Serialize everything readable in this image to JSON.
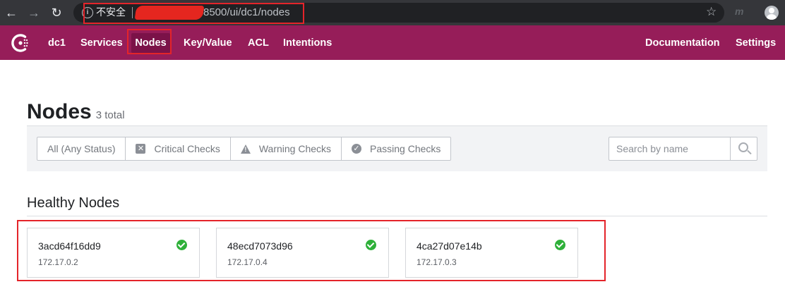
{
  "browser": {
    "back_icon": "arrow-left-icon",
    "forward_icon": "arrow-right-icon",
    "reload_icon": "reload-icon",
    "security_label": "不安全",
    "url_visible": "8500/ui/dc1/nodes",
    "bookmark_icon": "star-icon"
  },
  "header": {
    "accent_color": "#961d59",
    "datacenter": "dc1",
    "nav": {
      "services": "Services",
      "nodes": "Nodes",
      "keyvalue": "Key/Value",
      "acl": "ACL",
      "intentions": "Intentions",
      "documentation": "Documentation",
      "settings": "Settings"
    },
    "active_item": "Nodes"
  },
  "page": {
    "title": "Nodes",
    "count": "3 total"
  },
  "filters": {
    "options": [
      "All (Any Status)",
      "Critical Checks",
      "Warning Checks",
      "Passing Checks"
    ],
    "search_placeholder": "Search by name"
  },
  "section": {
    "title": "Healthy Nodes"
  },
  "nodes": [
    {
      "name": "3acd64f16dd9",
      "address": "172.17.0.2",
      "status": "passing"
    },
    {
      "name": "48ecd7073d96",
      "address": "172.17.0.4",
      "status": "passing"
    },
    {
      "name": "4ca27d07e14b",
      "address": "172.17.0.3",
      "status": "passing"
    }
  ],
  "colors": {
    "passing": "#2eb039",
    "annotation_red": "#e4242a"
  }
}
